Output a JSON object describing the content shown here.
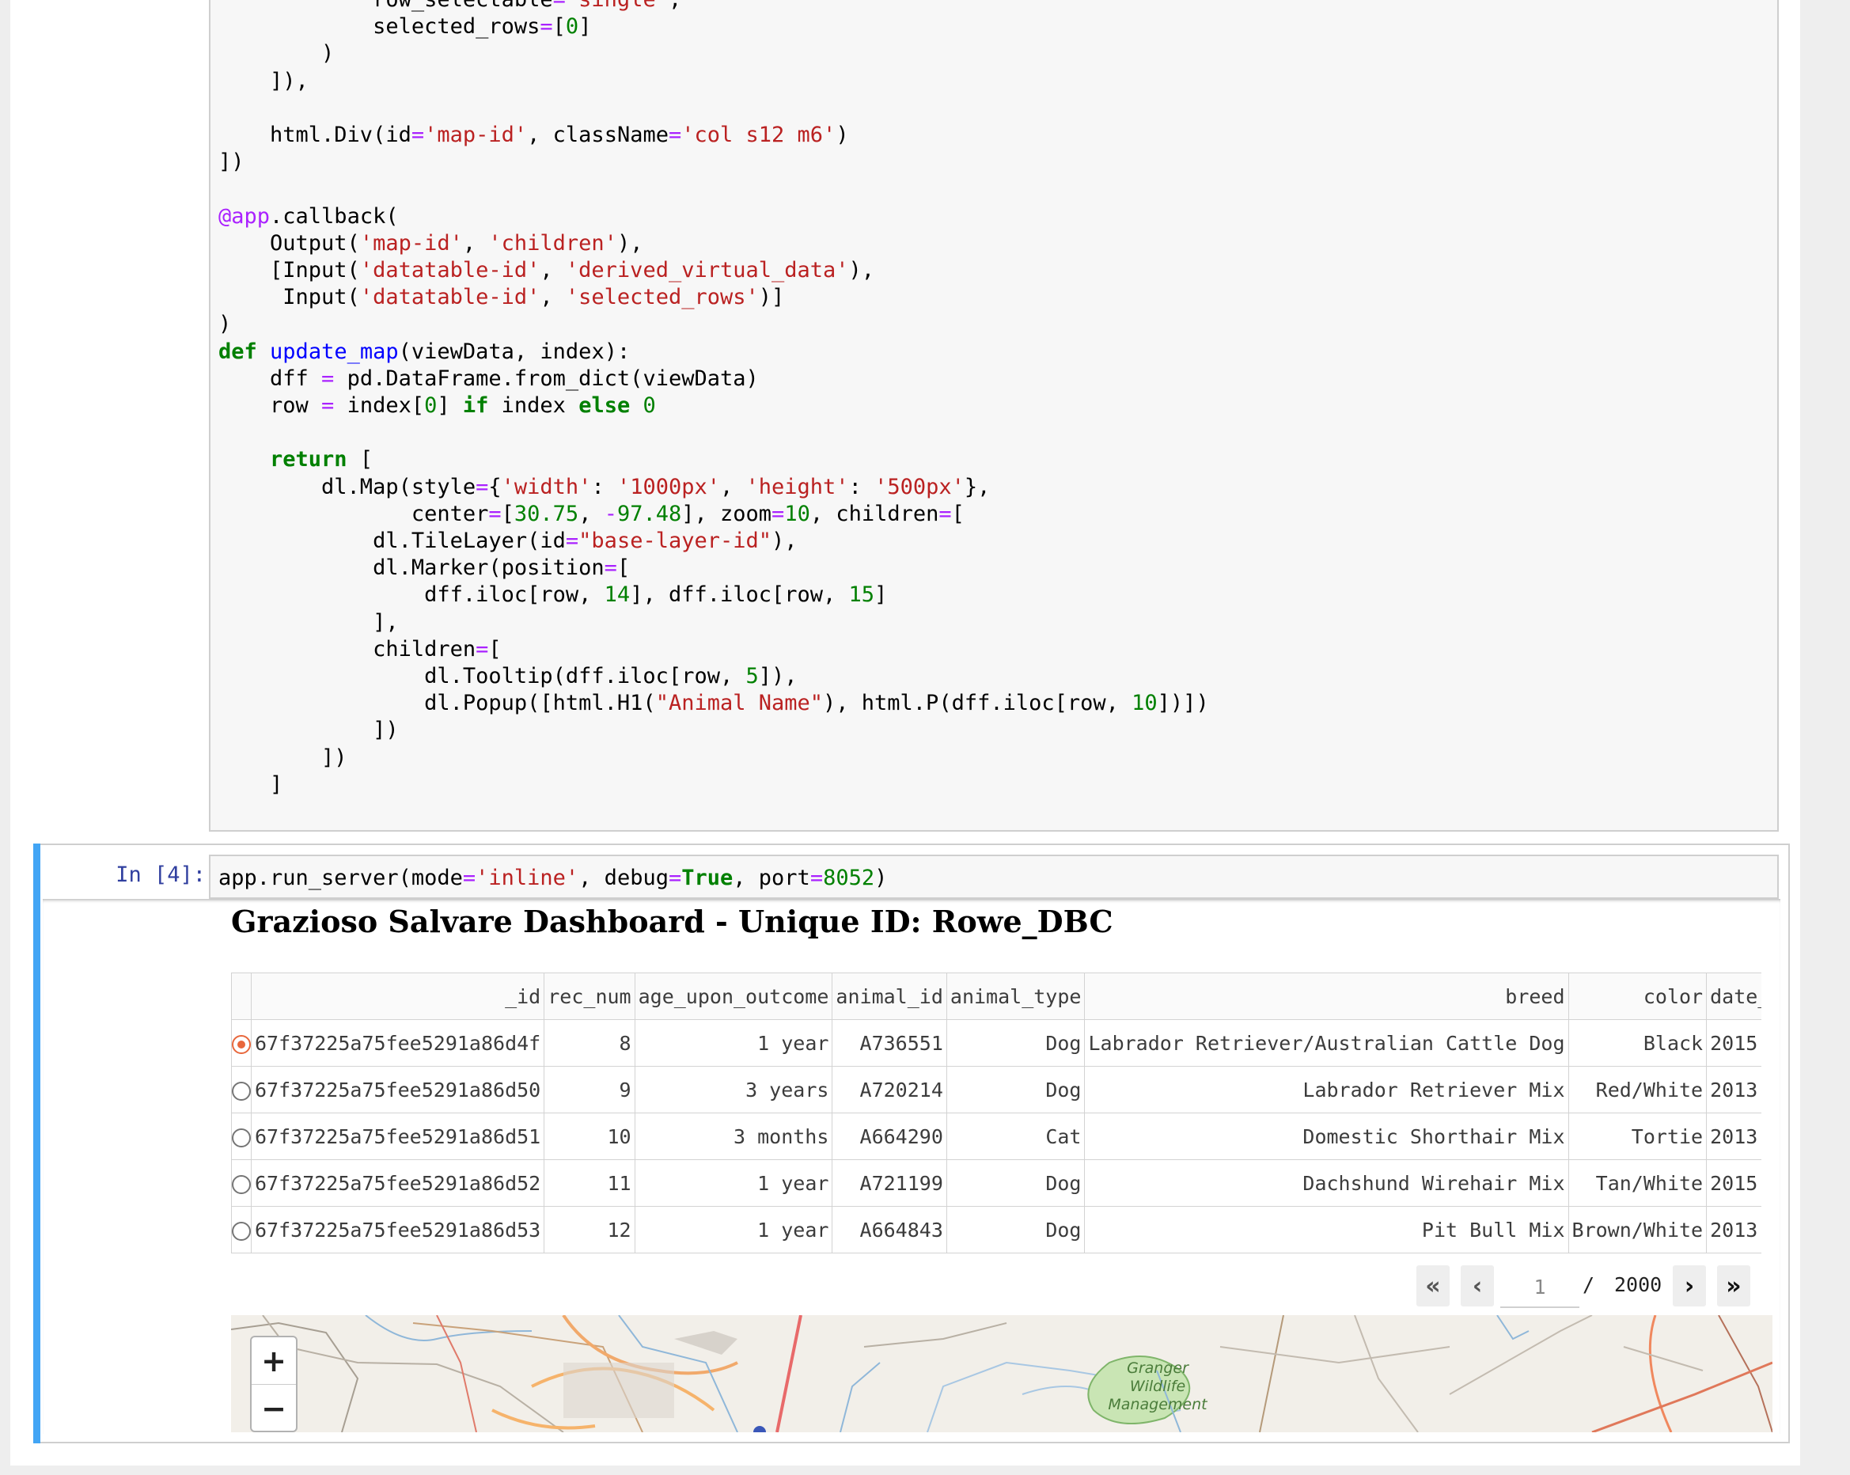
{
  "code_cell_1": {
    "lines": [
      "            row_selectable='single',",
      "            selected_rows=[0]",
      "        )",
      "    ]),",
      "",
      "    html.Div(id='map-id', className='col s12 m6')",
      "])",
      "",
      "@app.callback(",
      "    Output('map-id', 'children'),",
      "    [Input('datatable-id', 'derived_virtual_data'),",
      "     Input('datatable-id', 'selected_rows')]",
      ")",
      "def update_map(viewData, index):",
      "    dff = pd.DataFrame.from_dict(viewData)",
      "    row = index[0] if index else 0",
      "",
      "    return [",
      "        dl.Map(style={'width': '1000px', 'height': '500px'},",
      "               center=[30.75, -97.48], zoom=10, children=[",
      "            dl.TileLayer(id=\"base-layer-id\"),",
      "            dl.Marker(position=[",
      "                dff.iloc[row, 14], dff.iloc[row, 15]",
      "            ],",
      "            children=[",
      "                dl.Tooltip(dff.iloc[row, 5]),",
      "                dl.Popup([html.H1(\"Animal Name\"), html.P(dff.iloc[row, 10])])",
      "            ])",
      "        ])",
      "    ]"
    ]
  },
  "code_cell_2": {
    "prompt": "In [4]:",
    "code": "app.run_server(mode='inline', debug=True, port=8052)"
  },
  "dashboard": {
    "title": "Grazioso Salvare Dashboard - Unique ID: Rowe_DBC",
    "columns": [
      "_id",
      "rec_num",
      "age_upon_outcome",
      "animal_id",
      "animal_type",
      "breed",
      "color",
      "date_of"
    ],
    "rows": [
      {
        "selected": true,
        "cells": [
          "67f37225a75fee5291a86d4f",
          "8",
          "1 year",
          "A736551",
          "Dog",
          "Labrador Retriever/Australian Cattle Dog",
          "Black",
          "2015"
        ]
      },
      {
        "selected": false,
        "cells": [
          "67f37225a75fee5291a86d50",
          "9",
          "3 years",
          "A720214",
          "Dog",
          "Labrador Retriever Mix",
          "Red/White",
          "2013"
        ]
      },
      {
        "selected": false,
        "cells": [
          "67f37225a75fee5291a86d51",
          "10",
          "3 months",
          "A664290",
          "Cat",
          "Domestic Shorthair Mix",
          "Tortie",
          "2013"
        ]
      },
      {
        "selected": false,
        "cells": [
          "67f37225a75fee5291a86d52",
          "11",
          "1 year",
          "A721199",
          "Dog",
          "Dachshund Wirehair Mix",
          "Tan/White",
          "2015"
        ]
      },
      {
        "selected": false,
        "cells": [
          "67f37225a75fee5291a86d53",
          "12",
          "1 year",
          "A664843",
          "Dog",
          "Pit Bull Mix",
          "Brown/White",
          "2013"
        ]
      }
    ],
    "pagination": {
      "first": "«",
      "prev": "‹",
      "current_page": "1",
      "separator": "/",
      "total_pages": "2000",
      "next": "›",
      "last": "»"
    },
    "map": {
      "zoom_in": "+",
      "zoom_out": "−",
      "label_line1": "Granger",
      "label_line2": "Wildlife",
      "label_line3": "Management"
    }
  },
  "colors": {
    "active_cell_bar": "#42a5f5",
    "radio_selected": "#e8673c",
    "prompt": "#303f9f"
  }
}
